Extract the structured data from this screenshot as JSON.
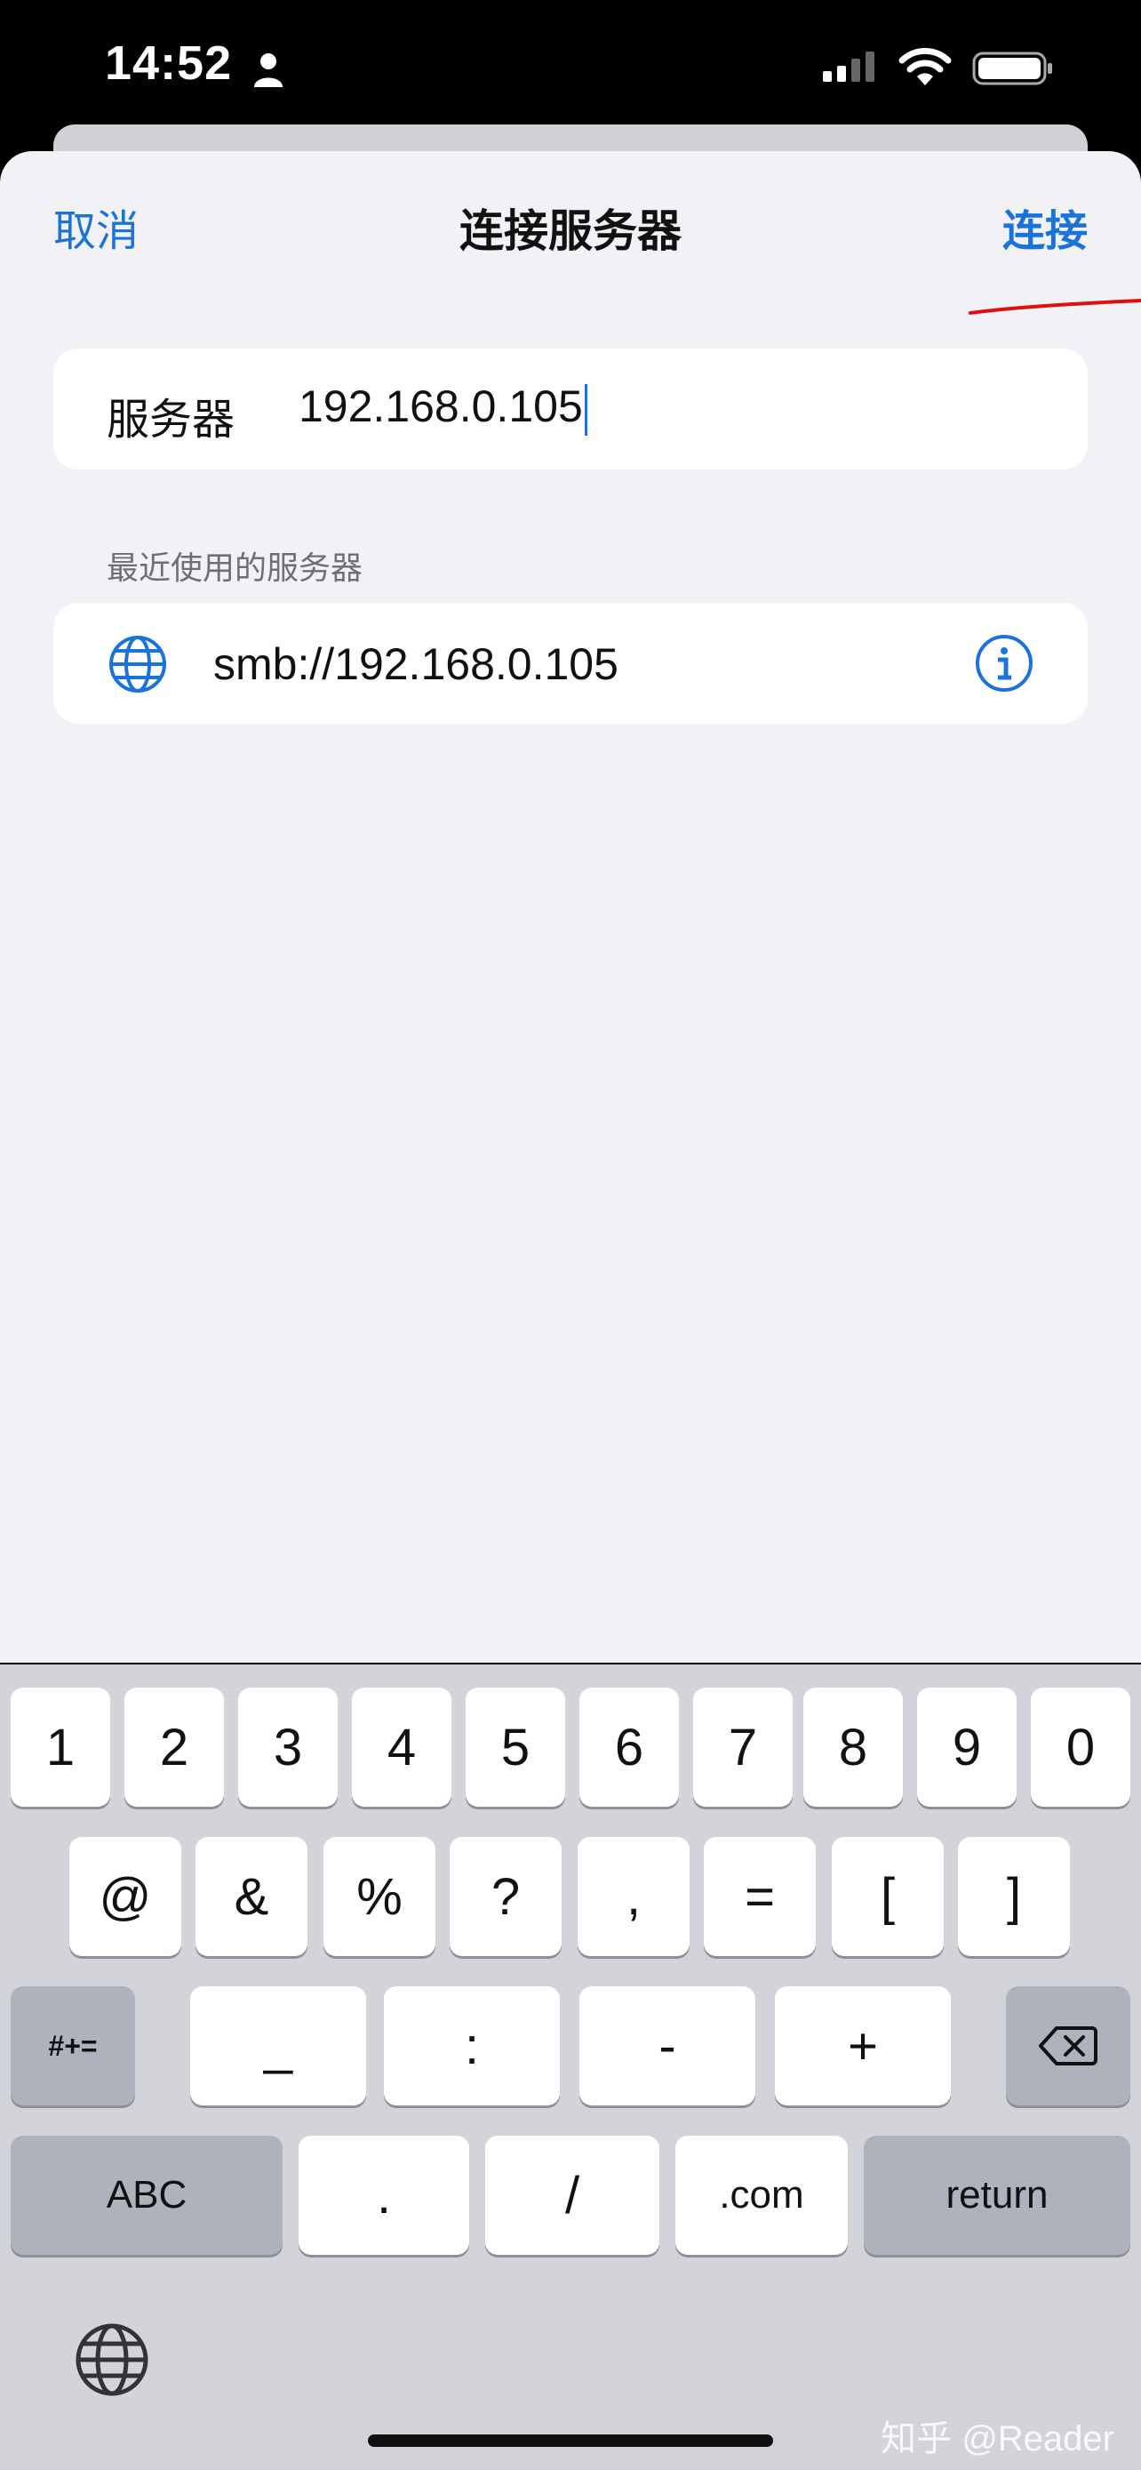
{
  "status_bar": {
    "time": "14:52"
  },
  "nav": {
    "cancel": "取消",
    "title": "连接服务器",
    "connect": "连接"
  },
  "server_field": {
    "label": "服务器",
    "value": "192.168.0.105"
  },
  "recent": {
    "header": "最近使用的服务器",
    "items": [
      {
        "address": "smb://192.168.0.105"
      }
    ]
  },
  "keyboard": {
    "row1": [
      "1",
      "2",
      "3",
      "4",
      "5",
      "6",
      "7",
      "8",
      "9",
      "0"
    ],
    "row2": [
      "@",
      "&",
      "%",
      "?",
      ",",
      "=",
      "[",
      "]"
    ],
    "row3": {
      "symbols_key": "#+=",
      "keys": [
        "_",
        ":",
        "-",
        "+"
      ]
    },
    "row4": {
      "abc_key": "ABC",
      "keys": [
        ".",
        "/",
        ".com"
      ],
      "return_key": "return"
    }
  },
  "watermark": "知乎 @Reader",
  "colors": {
    "accent": "#1a73d9",
    "sheet_bg": "#f1f1f6",
    "keyboard_bg": "#d2d4da"
  }
}
